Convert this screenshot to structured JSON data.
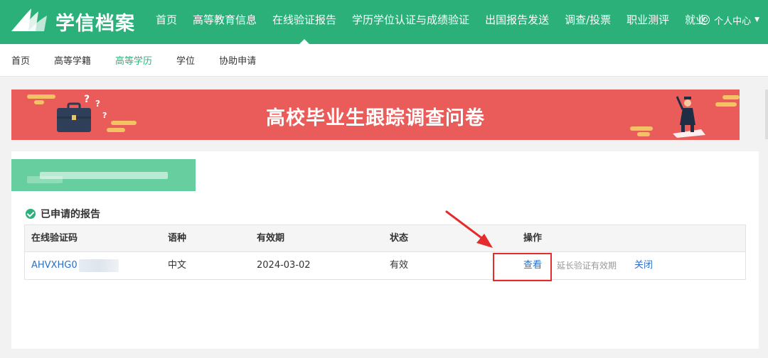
{
  "header": {
    "logo_text": "学信档案",
    "nav": [
      {
        "label": "首页"
      },
      {
        "label": "高等教育信息"
      },
      {
        "label": "在线验证报告",
        "active": true
      },
      {
        "label": "学历学位认证与成绩验证"
      },
      {
        "label": "出国报告发送"
      },
      {
        "label": "调查/投票"
      },
      {
        "label": "职业测评"
      },
      {
        "label": "就业"
      }
    ],
    "user_center": "个人中心"
  },
  "subnav": {
    "items": [
      {
        "label": "首页"
      },
      {
        "label": "高等学籍"
      },
      {
        "label": "高等学历",
        "active": true
      },
      {
        "label": "学位"
      },
      {
        "label": "协助申请"
      }
    ]
  },
  "banner": {
    "title": "高校毕业生跟踪调查问卷"
  },
  "section": {
    "title": "已申请的报告"
  },
  "table": {
    "headers": [
      "在线验证码",
      "语种",
      "有效期",
      "状态",
      "操作"
    ],
    "rows": [
      {
        "code": "AHVXHG0",
        "language": "中文",
        "expiry": "2024-03-02",
        "status": "有效",
        "actions": {
          "view": "查看",
          "extend": "延长验证有效期",
          "close": "关闭"
        }
      }
    ]
  },
  "colors": {
    "brand_green": "#2cb07a",
    "banner_red": "#e95c59",
    "link_blue": "#2a6fc9",
    "annotation_red": "#e52b2b"
  }
}
